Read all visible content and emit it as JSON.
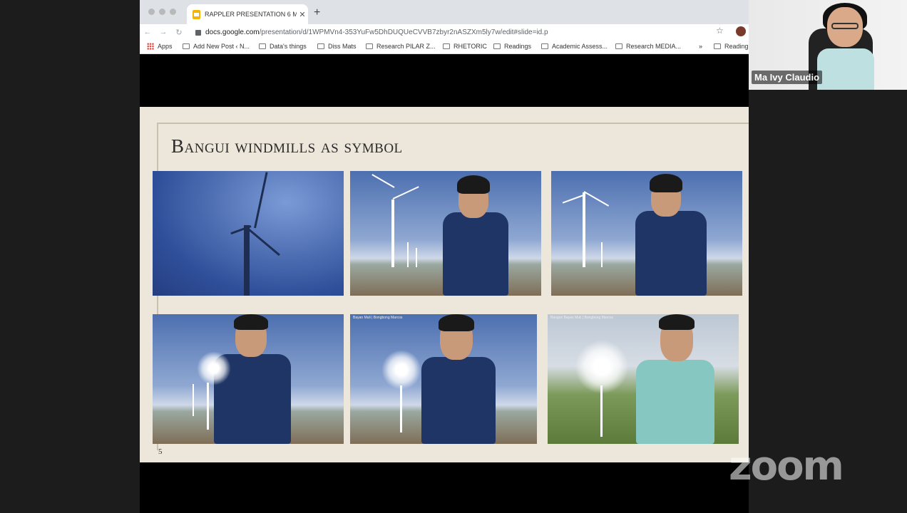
{
  "browser": {
    "tab_title": "RAPPLER PRESENTATION 6 M...",
    "tab_close": "✕",
    "new_tab": "+",
    "url_host": "docs.google.com",
    "url_path": "/presentation/d/1WPMVn4-353YuFw5DhDUQUeCVVB7zbyr2nASZXm5ly7w/edit#slide=id.p",
    "bookmarks": [
      {
        "label": "Apps",
        "icon": "apps-grid-icon"
      },
      {
        "label": "Add New Post ‹ N...",
        "icon": "site-icon"
      },
      {
        "label": "Data's things",
        "icon": "folder-icon"
      },
      {
        "label": "Diss Mats",
        "icon": "folder-icon"
      },
      {
        "label": "Research PILAR Z...",
        "icon": "folder-icon"
      },
      {
        "label": "RHETORIC",
        "icon": "folder-icon"
      },
      {
        "label": "Readings",
        "icon": "folder-icon"
      },
      {
        "label": "Academic Assess...",
        "icon": "site-icon"
      },
      {
        "label": "Research MEDIA...",
        "icon": "folder-icon"
      },
      {
        "label": "»",
        "icon": ""
      },
      {
        "label": "Reading",
        "icon": "reading-list-icon"
      }
    ]
  },
  "slide": {
    "title": "Bangui windmills as symbol",
    "page_number": "5",
    "photos": [
      {
        "caption": ""
      },
      {
        "caption": ""
      },
      {
        "caption": ""
      },
      {
        "caption": ""
      },
      {
        "caption": "Bayan Muli | Bongbong Marcos"
      },
      {
        "caption": "Bangon Bayan Muli | Bongbong Marcos"
      }
    ]
  },
  "participant": {
    "name": "Ma Ivy Claudio"
  },
  "zoom_logo": "zoom"
}
